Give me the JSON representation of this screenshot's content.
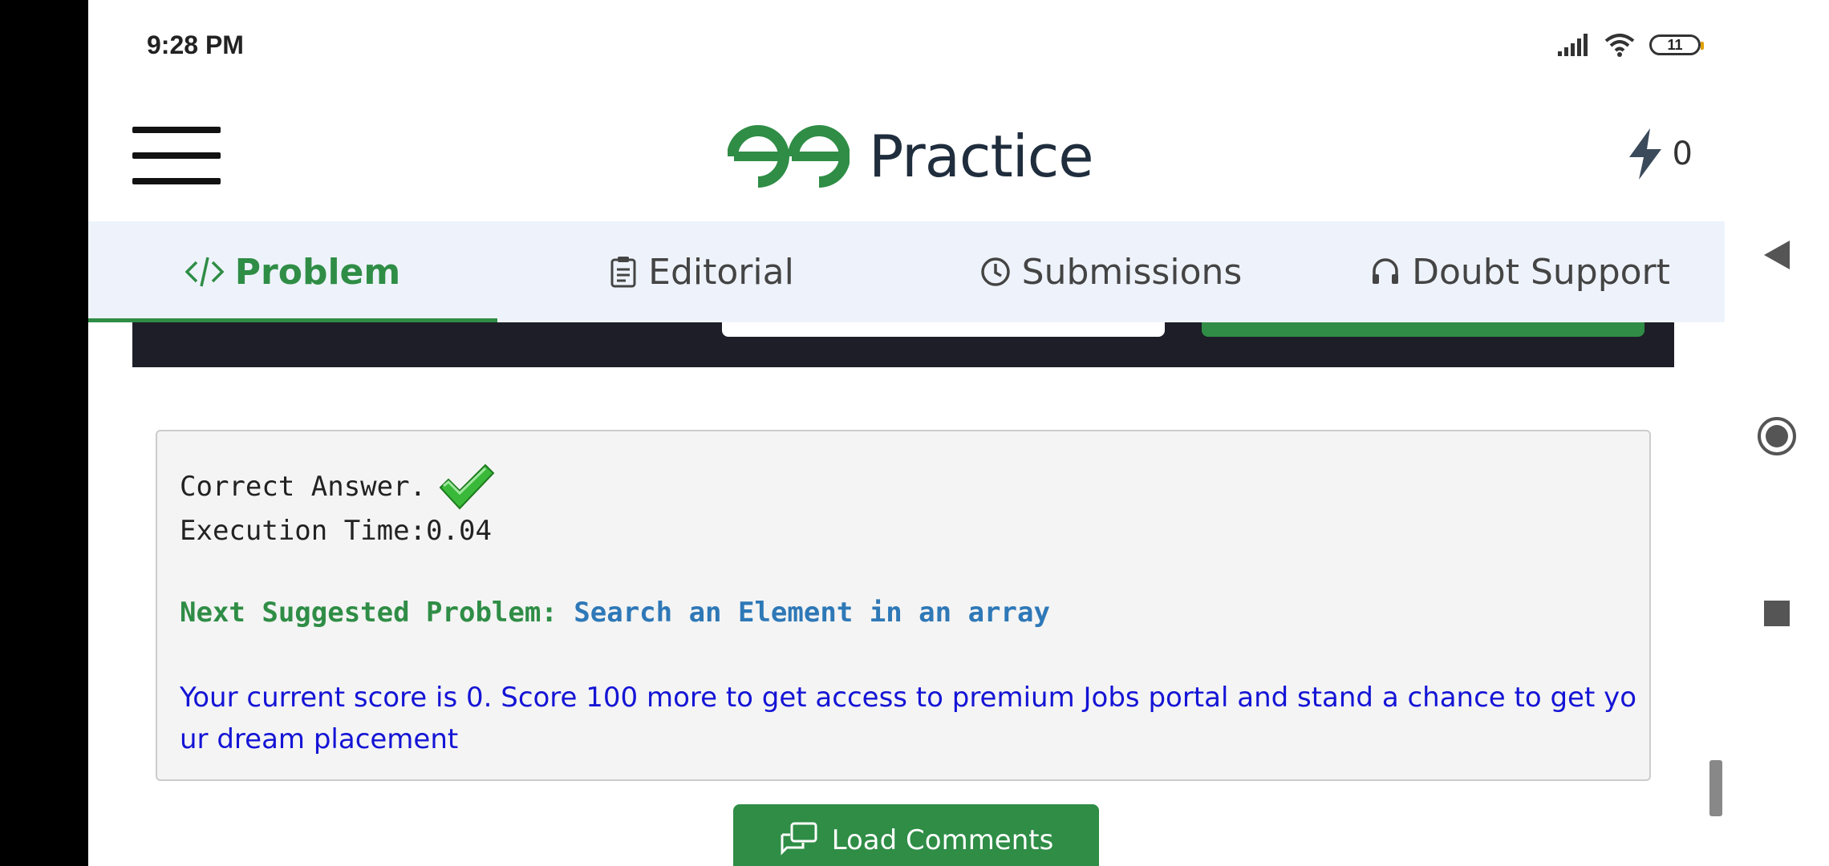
{
  "status_bar": {
    "time": "9:28 PM",
    "battery": "11"
  },
  "header": {
    "logo_text": "Practice",
    "streak_count": "0",
    "brand_color": "#2f8d46"
  },
  "tabs": [
    {
      "label": "Problem",
      "icon": "code-icon",
      "active": true
    },
    {
      "label": "Editorial",
      "icon": "document-icon",
      "active": false
    },
    {
      "label": "Submissions",
      "icon": "clock-icon",
      "active": false
    },
    {
      "label": "Doubt Support",
      "icon": "headset-icon",
      "active": false
    }
  ],
  "result": {
    "status": "Correct Answer.",
    "execution_time": "Execution Time:0.04",
    "next_label": "Next Suggested Problem:",
    "next_problem": "Search an Element in an array",
    "score_message": "Your current score is 0. Score 100 more to get access to premium Jobs portal and stand a chance to get your dream placement"
  },
  "load_comments_label": "Load Comments",
  "nav": {
    "back": "back-triangle-icon",
    "home": "home-circle-icon",
    "recents": "recents-square-icon"
  }
}
